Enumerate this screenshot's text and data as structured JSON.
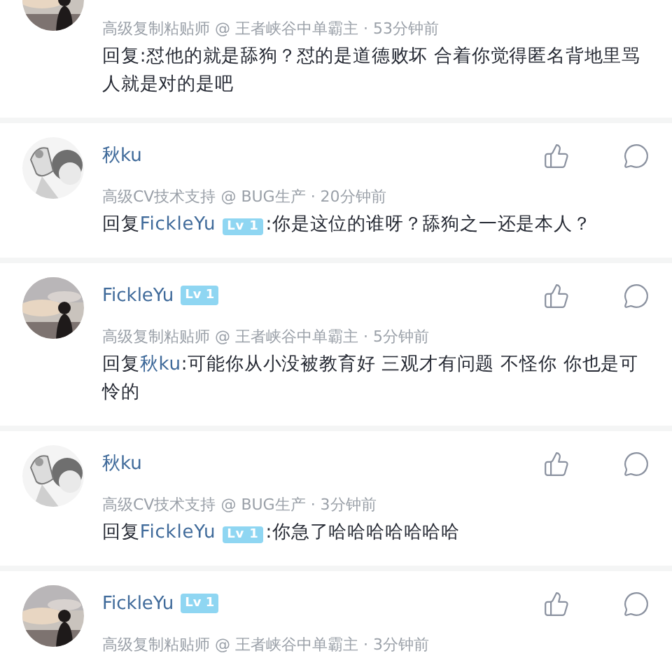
{
  "comments": [
    {
      "meta": "高级复制粘贴师 @ 王者峡谷中单霸主 · 53分钟前",
      "reply": {
        "prefix": "回复",
        "text": ":怼他的就是舔狗？怼的是道德败坏 合着你觉得匿名背地里骂人就是对的是吧"
      }
    },
    {
      "author": "秋ku",
      "meta": "高级CV技术支持 @ BUG生产 · 20分钟前",
      "reply": {
        "prefix": "回复",
        "mention": "FickleYu",
        "mention_badge": "Lv 1",
        "text": ":你是这位的谁呀？舔狗之一还是本人？"
      }
    },
    {
      "author": "FickleYu",
      "badge": "Lv 1",
      "meta": "高级复制粘贴师 @ 王者峡谷中单霸主 · 5分钟前",
      "reply": {
        "prefix": "回复",
        "mention": "秋ku",
        "text": ":可能你从小没被教育好 三观才有问题 不怪你 你也是可怜的"
      }
    },
    {
      "author": "秋ku",
      "meta": "高级CV技术支持 @ BUG生产 · 3分钟前",
      "reply": {
        "prefix": "回复",
        "mention": "FickleYu",
        "mention_badge": "Lv 1",
        "text": ":你急了哈哈哈哈哈哈哈"
      }
    },
    {
      "author": "FickleYu",
      "badge": "Lv 1",
      "meta": "高级复制粘贴师 @ 王者峡谷中单霸主 · 3分钟前"
    }
  ]
}
